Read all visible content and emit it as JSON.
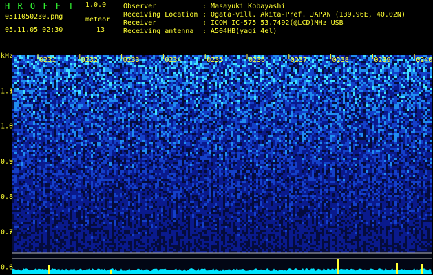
{
  "header": {
    "app_title": "H R O F F T",
    "version": "1.0.0",
    "filename": "0511050230.png",
    "datetime": "05.11.05 02:30",
    "meteor_label": "meteor",
    "meteor_count": "13",
    "info": [
      {
        "label": "Observer",
        "value": "Masayuki Kobayashi"
      },
      {
        "label": "Receiving Location",
        "value": "Ogata-vill. Akita-Pref. JAPAN (139.96E, 40.02N)"
      },
      {
        "label": "Receiver",
        "value": "ICOM IC-575 53.7492(@LCD)MHz USB"
      },
      {
        "label": "Receiving antenna",
        "value": "A504HB(yagi 4el)"
      }
    ],
    "separator": ":"
  },
  "chart_data": {
    "type": "heatmap",
    "title": "",
    "ylabel": "kHz",
    "x_ticks": [
      "0231",
      "0232",
      "0233",
      "0234",
      "0235",
      "0236",
      "0237",
      "0238",
      "0239",
      "0240"
    ],
    "y_ticks": [
      "1.1",
      "1.0",
      "0.9",
      "0.8",
      "0.7",
      "0.6"
    ],
    "ylim": [
      0.58,
      1.2
    ],
    "colors": {
      "background": "#000000",
      "low": "#0a1a8c",
      "high": "#40e0ff",
      "text": "#ffff33",
      "title": "#33ff33",
      "meteor": "#ffff33",
      "baseline": "#00e5ff"
    }
  }
}
